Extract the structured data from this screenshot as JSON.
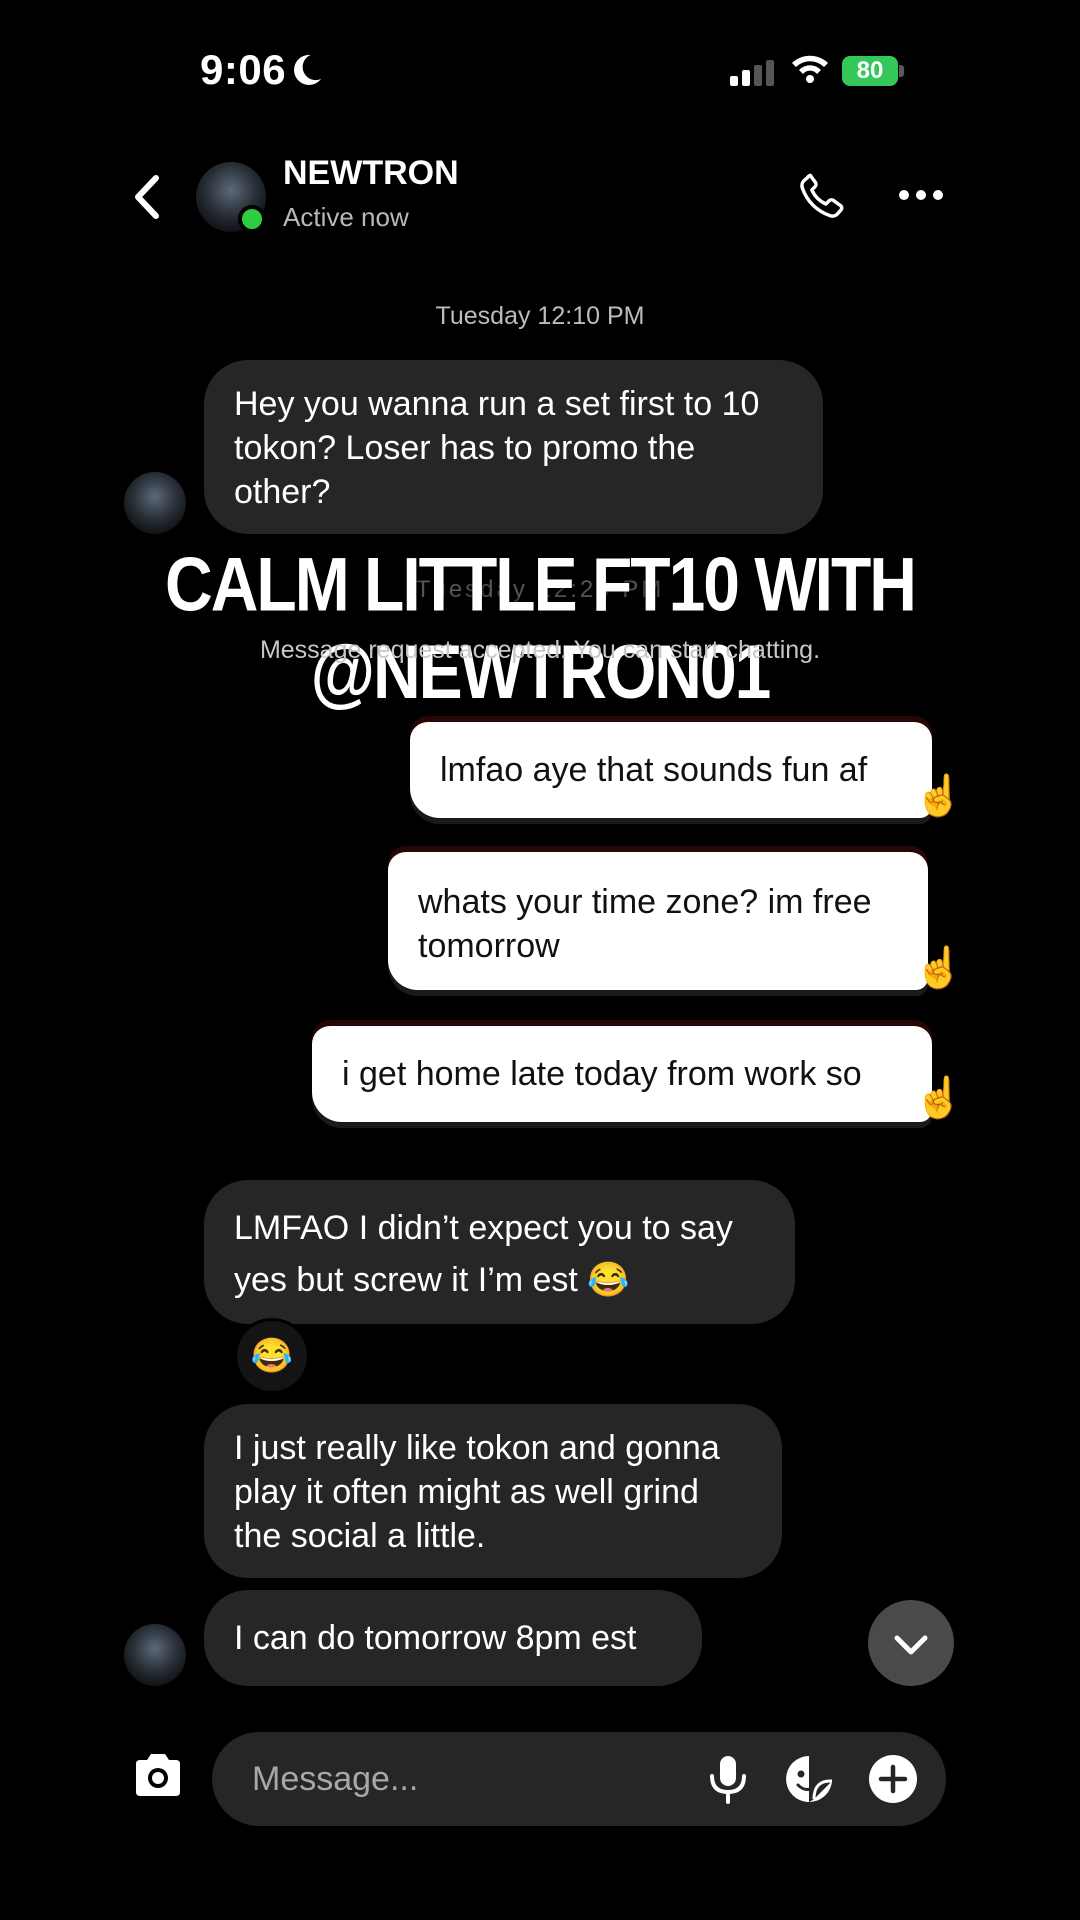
{
  "status_bar": {
    "time": "9:06",
    "battery": "80"
  },
  "header": {
    "name": "NEWTRON",
    "status": "Active now"
  },
  "chat": {
    "timestamp": "Tuesday 12:10 PM",
    "messages": [
      {
        "side": "incoming",
        "text": "Hey you wanna run a set first to 10 tokon? Loser has to promo the other?"
      },
      {
        "side": "outgoing",
        "text": "lmfao aye that sounds fun af"
      },
      {
        "side": "outgoing",
        "text": "whats your time zone? im free tomorrow"
      },
      {
        "side": "outgoing",
        "text": "i get home late today from work so"
      },
      {
        "side": "incoming",
        "text": "LMFAO I didn’t expect you to say yes but screw it I’m est 😂",
        "reaction": "😂"
      },
      {
        "side": "incoming",
        "text": "I just really like tokon and gonna play it often might as well grind the social a little."
      },
      {
        "side": "incoming",
        "text": "I can do tomorrow 8pm est"
      }
    ],
    "overlay_title": "CALM LITTLE FT10 WITH @NEWTRON01",
    "overlay_underlay": "Tuesday 12:20 PM",
    "request_notice": "Message request accepted. You can start chatting."
  },
  "composer": {
    "placeholder": "Message..."
  }
}
